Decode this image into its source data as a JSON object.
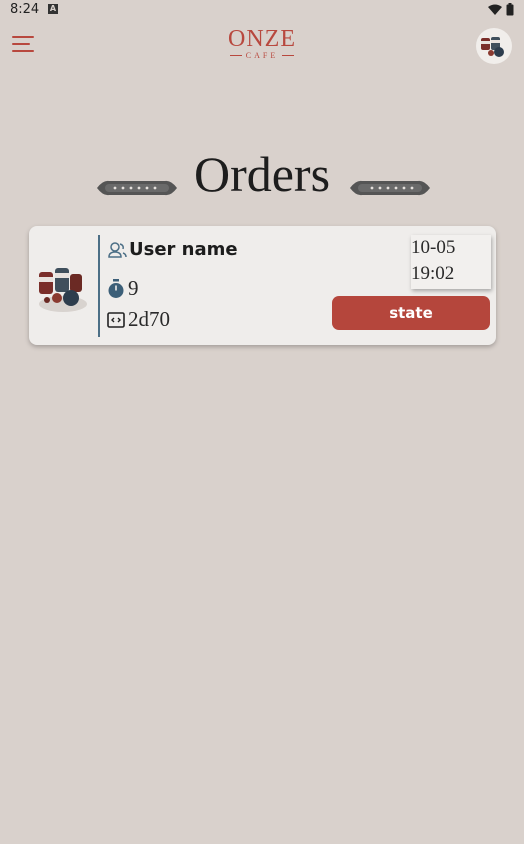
{
  "status_bar": {
    "time": "8:24",
    "notification_badge": "A"
  },
  "app_bar": {
    "logo_main": "ONZE",
    "logo_sub": "CAFE",
    "brand_color": "#b8483e"
  },
  "page": {
    "title": "Orders"
  },
  "orders": [
    {
      "user_name": "User name",
      "item_count": "9",
      "order_id": "2d70",
      "date": "10-05",
      "time": "19:02",
      "state_label": "state"
    }
  ],
  "colors": {
    "background": "#d9d1cc",
    "card": "#efedeb",
    "accent": "#b5463c",
    "divider": "#4c6f86"
  }
}
